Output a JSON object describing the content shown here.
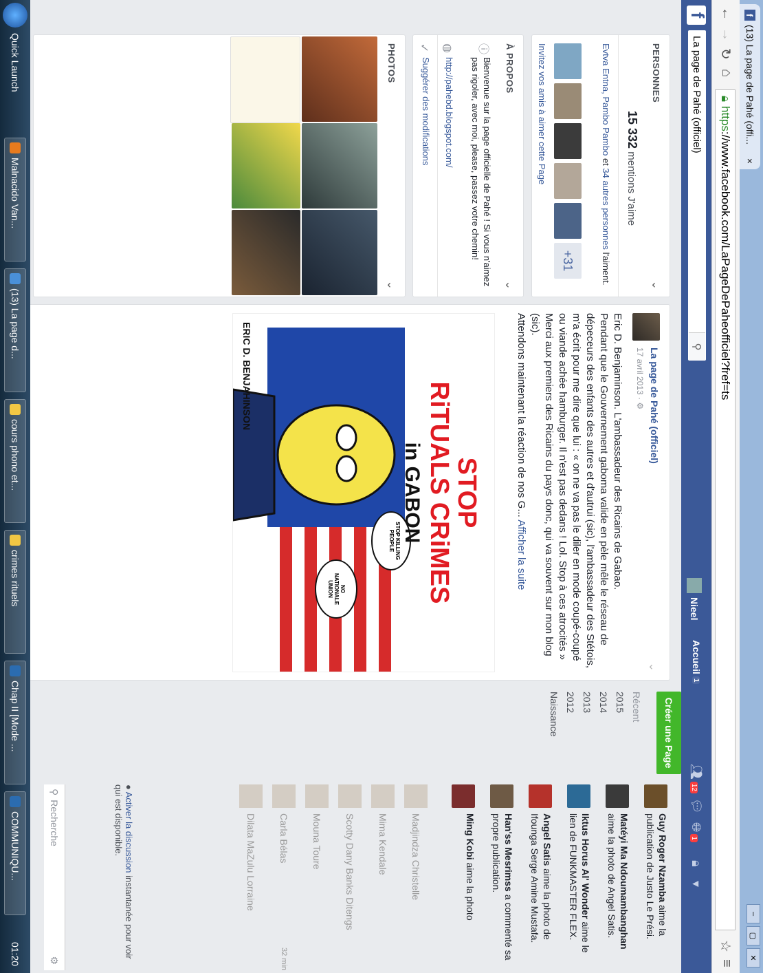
{
  "browser": {
    "tab_title": "(13) La page de Pahé (offi...",
    "tab_close": "×",
    "url_https": "https",
    "url_rest": "://www.facebook.com/LaPageDePaheofficiel?fref=ts"
  },
  "fb": {
    "search_value": "La page de Pahé (officiel)",
    "user_name": "Nieel",
    "home_label": "Accueil",
    "home_badge": "1",
    "friend_badge": "12",
    "notif_badge": "1",
    "create_page": "Créer une Page"
  },
  "people": {
    "header": "PERSONNES",
    "likes_count": "15 332",
    "likes_label": "mentions J'aime",
    "friends_names": "Evtva Entna, Pambo Pambo",
    "friends_and": "et",
    "friends_others": "34 autres personnes",
    "friends_suffix": "l'aiment.",
    "more_count": "+31",
    "invite": "Invitez vos amis à aimer cette Page"
  },
  "about": {
    "header": "À PROPOS",
    "desc": "Bienvenue sur la page officielle de Pahé ! Si vous n'aimez pas rigoler, avec moi, please, passez votre chemin!",
    "website": "http://pahebd.blogspot.com/",
    "suggest": "Suggérer des modifications"
  },
  "photos": {
    "header": "PHOTOS"
  },
  "post": {
    "author": "La page de Pahé (officiel)",
    "date": "17 avril 2013 ·",
    "text1": "Eric D. Benjaminson. L'ambassadeur des Ricains de Gabao.",
    "text2": "Pendant que le Gouvernement gaboma valide en pèle mêle le réseau de dépeceurs des enfants des autres et d'autrui (sic), l'ambassadeur des Stétois, m'a écrit pour me dire que lui : « on ne va pas le diler en mode coupé-coupé ou viande achée hamburger. Il n'est pas dedans ! Lol. Stop à ces atrocités »",
    "text3": "Merci aux premiers des Ricains du pays donc, qui va souvent sur mon blog (sic).",
    "text4": "Attendons maintenant la réaction de nos G...",
    "see_more": "Afficher la suite",
    "img_title1": "STOP",
    "img_title2": "RiTUALS CRiMES",
    "img_title3": "in GABON",
    "img_bubble1": "STOP KILLING PEOPLE",
    "img_bubble2": "NO NATIONALE UNION",
    "img_caption": "ERIC D. BENJAHINSON"
  },
  "timeline": [
    "Récent",
    "2015",
    "2014",
    "2013",
    "2012",
    "Naissance"
  ],
  "ticker": [
    {
      "name": "Guy Roger Nzamba",
      "action": "aime la publication de Justo Le Prési."
    },
    {
      "name": "Matéyi Ma Ndoumambanghan",
      "action": "aime la photo de Angel Satis."
    },
    {
      "name": "Iktus Horus Al' Wonder",
      "action": "aime le lien de FUNKMASTER FLEX."
    },
    {
      "name": "Angel Satis",
      "action": "aime la photo de Ifounga Serge Amine Mustafa."
    },
    {
      "name": "Han'ss Mesrimss",
      "action": "a commenté sa propre publication."
    },
    {
      "name": "Ming Kobi",
      "action": "aime la photo"
    }
  ],
  "chat": [
    {
      "name": "Madjindza Christelle",
      "time": ""
    },
    {
      "name": "Mima Kendale",
      "time": ""
    },
    {
      "name": "Scotty Dany Banks Ditengs",
      "time": ""
    },
    {
      "name": "Mouna Toure",
      "time": ""
    },
    {
      "name": "Carla Bélas",
      "time": "32 min"
    },
    {
      "name": "Dilata MaZulu Lorraine",
      "time": ""
    }
  ],
  "chat_footer": {
    "activate_link": "Activer la discussion",
    "activate_text": "instantanée pour voir qui est disponible.",
    "search": "Recherche"
  },
  "taskbar": {
    "quick_launch": "Quick Launch",
    "tasks": [
      "Malnacido Van...",
      "(13) La page d...",
      "cours phono et...",
      "crimes rituels",
      "Chap II [Mode ...",
      "COMMUNIQU..."
    ],
    "clock": "01:20"
  },
  "colors": {
    "fb_blue": "#3b5998",
    "link": "#365899",
    "create_green": "#42b72a",
    "badge_red": "#fa3e3e"
  }
}
